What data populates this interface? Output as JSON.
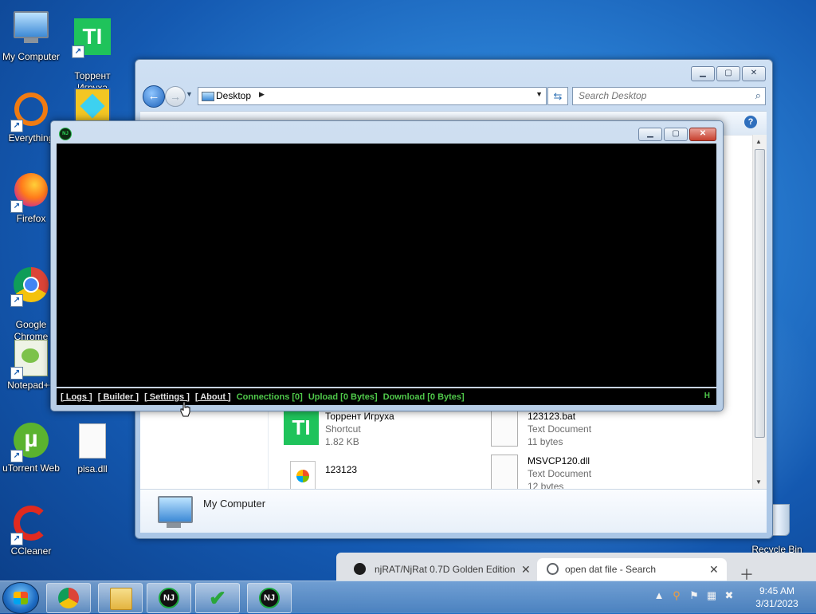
{
  "desktop": {
    "icons": {
      "my_computer": "My Computer",
      "torrent": "Торрент\nИгруха",
      "everything": "Everything",
      "firefox": "Firefox",
      "chrome": "Google\nChrome",
      "notepadpp": "Notepad++",
      "utorrent": "uTorrent Web",
      "pisa": "pisa.dll",
      "ccleaner": "CCleaner",
      "recycle": "Recycle Bin"
    }
  },
  "explorer": {
    "address": "Desktop",
    "search_placeholder": "Search Desktop",
    "files": [
      {
        "name": "Торрент  Игруха",
        "type": "Shortcut",
        "size": "1.82 KB"
      },
      {
        "name": "123123.bat",
        "type": "Text Document",
        "size": "11 bytes"
      },
      {
        "name": "123123",
        "type": "",
        "size": ""
      },
      {
        "name": "MSVCP120.dll",
        "type": "Text Document",
        "size": "12 bytes"
      }
    ],
    "details_title": "My Computer"
  },
  "njrat": {
    "menu": [
      "[ Logs ]",
      "[ Builder ]",
      "[ Settings ]",
      "[ About ]"
    ],
    "connections": "Connections [0]",
    "upload": "Upload [0 Bytes]",
    "download": "Download [0 Bytes]",
    "corner": "H"
  },
  "browser": {
    "tabs": [
      {
        "title": "njRAT/NjRat 0.7D Golden Edition"
      },
      {
        "title": "open dat file - Search"
      }
    ]
  },
  "taskbar": {
    "time": "9:45 AM",
    "date": "3/31/2023"
  },
  "colors": {
    "console_bg": "#000000",
    "status_green": "#4fc84a",
    "desktop_blue": "#1459b1"
  }
}
